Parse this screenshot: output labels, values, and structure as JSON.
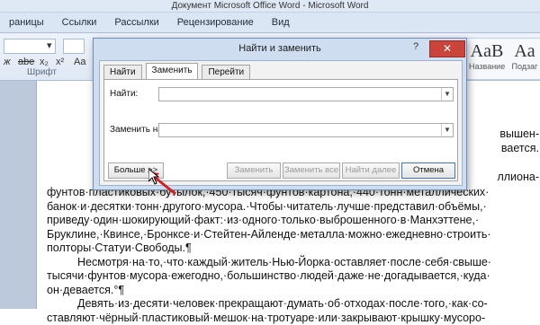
{
  "window": {
    "title": "Документ Microsoft Office Word - Microsoft Word"
  },
  "ribbon": {
    "tabs": [
      "раницы",
      "Ссылки",
      "Рассылки",
      "Рецензирование",
      "Вид"
    ],
    "font_group_label": "Шрифт",
    "styles": [
      {
        "sample": "AaB",
        "name": "Название"
      },
      {
        "sample": "Aa",
        "name": "Подзаг"
      }
    ]
  },
  "dialog": {
    "title": "Найти и заменить",
    "help": "?",
    "close": "✕",
    "tabs": [
      "Найти",
      "Заменить",
      "Перейти"
    ],
    "active_tab": "Заменить",
    "find_label": "Найти:",
    "replace_label": "Заменить на:",
    "buttons": {
      "more": "Больше >>",
      "replace": "Заменить",
      "replace_all": "Заменить все",
      "find_next": "Найти далее",
      "cancel": "Отмена"
    }
  },
  "document": {
    "right_fragments": [
      "вышен-",
      "вается.",
      "ллиона-"
    ],
    "lines": [
      "фунтов·пластиковых·бутылок,·450·тысяч·фунтов·картона,·440·тонн·металлических·",
      "банок·и·десятки·тонн·другого·мусора.·Чтобы·читатель·лучше·представил·объёмы,·",
      "приведу·один·шокирующий·факт:·из·одного·только·выброшенного·в·Манхэттене,·",
      "Бруклине,·Квинсе,·Бронксе·и·Стейтен-Айленде·металла·можно·ежедневно·строить·",
      "полторы·Статуи·Свободы.¶"
    ],
    "para2": [
      "Несмотря·на·то,·что·каждый·житель·Нью-Йорка·оставляет·после·себя·свыше·",
      "тысячи·фунтов·мусора·ежегодно,·большинство·людей·даже·не·догадывается,·куда·",
      "он·девается.°¶"
    ],
    "para3": [
      "Девять·из·десяти·человек·прекращают·думать·об·отходах·после·того,·как·со-",
      "ставляют·чёрный·пластиковый·мешок·на·тротуаре·или·закрывают·крышку·мусоро-"
    ]
  }
}
